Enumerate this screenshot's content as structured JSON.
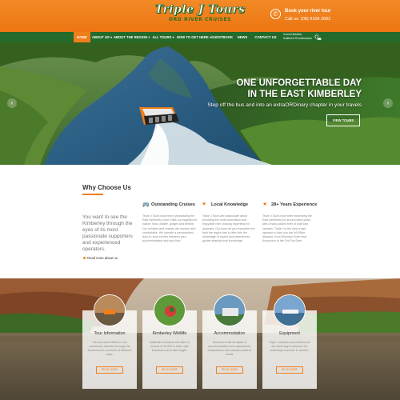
{
  "header": {
    "logo_main": "Triple J Tours",
    "logo_sub": "ORD RIVER CRUISES",
    "book_title": "Book your river tour",
    "book_phone": "Call us: (08) 9168 2682",
    "phone_icon": "phone-icon"
  },
  "nav": {
    "items": [
      {
        "label": "HOME"
      },
      {
        "label": "ABOUT US ▾"
      },
      {
        "label": "ABOUT THE REGION ▾"
      },
      {
        "label": "ALL TOURS ▾"
      },
      {
        "label": "HOW TO GET HERE ▾"
      },
      {
        "label": "GUESTBOOK"
      },
      {
        "label": "NEWS"
      },
      {
        "label": "CONTACT US"
      }
    ],
    "weather_line1": "Current Weather",
    "weather_line2": "Scattered Thunderstorms",
    "weather_icon": "sun-cloud-icon",
    "accent_color": "#246a2a",
    "active_color": "#f07e1a"
  },
  "hero": {
    "title_line1": "ONE UNFORGETTABLE DAY",
    "title_line2": "IN THE EAST KIMBERLEY",
    "subtitle": "Step off the bus and into an extraORDinary chapter in your travels",
    "button": "VIEW TOURS",
    "prev_icon": "chevron-left-icon",
    "next_icon": "chevron-right-icon"
  },
  "why": {
    "title": "Why Choose Us",
    "intro": "You want to see the Kimberley through the eyes of its most passionate supporters and experienced operators.",
    "more_link": "Read more about us",
    "features": [
      {
        "icon": "bus-icon",
        "title": "Outstanding Cruises",
        "text": "Triple J Tours have been showcasing the East Kimberley since 1988. As magnificent nature, flora, wildlife, gorges and terrible. Our vehicles and vessels are modern and comfortable. We operate a personalised, door-to-door service between your accommodation and your tour."
      },
      {
        "icon": "heart-icon",
        "title": "Local Knowledge",
        "text": "Triple J Tours are passionate about providing the most informative and enjoyable river cruising experience in Australia. Our tours let you encounter the best the region has to offer with the advantage of expert and experienced guides sharing local knowledge."
      },
      {
        "icon": "star-icon",
        "title": "28+ Years Experience",
        "text": "Triple J Tours have been traversing the East Kimberley for around thirty years, with a hand-picked fleet of craft and vehicles. Triple J is the only cruise operator to take you the full 55km distance, from Diversion Dam near Kununurra to the Ord Top Dam."
      }
    ]
  },
  "cards": [
    {
      "title": "Tour Information",
      "text": "You can travel 55km in one continuous direction through the Kununurra in a number of different ways.",
      "button": "READ MORE"
    },
    {
      "title": "Kimberley Wildlife",
      "text": "Waterbird numbers are often in excess of 20,000 in both Lake Kununurra and Lake Argyle.",
      "button": "READ MORE"
    },
    {
      "title": "Accommodation",
      "text": "Kununurra has all styles of accommodation from apartments, backpackers and caravan parks to hotels.",
      "button": "READ MORE"
    },
    {
      "title": "Equipment",
      "text": "Triple J vessels and vehicles are the ideal way to traverse the waterways and tour in comfort.",
      "button": "READ MORE"
    }
  ]
}
